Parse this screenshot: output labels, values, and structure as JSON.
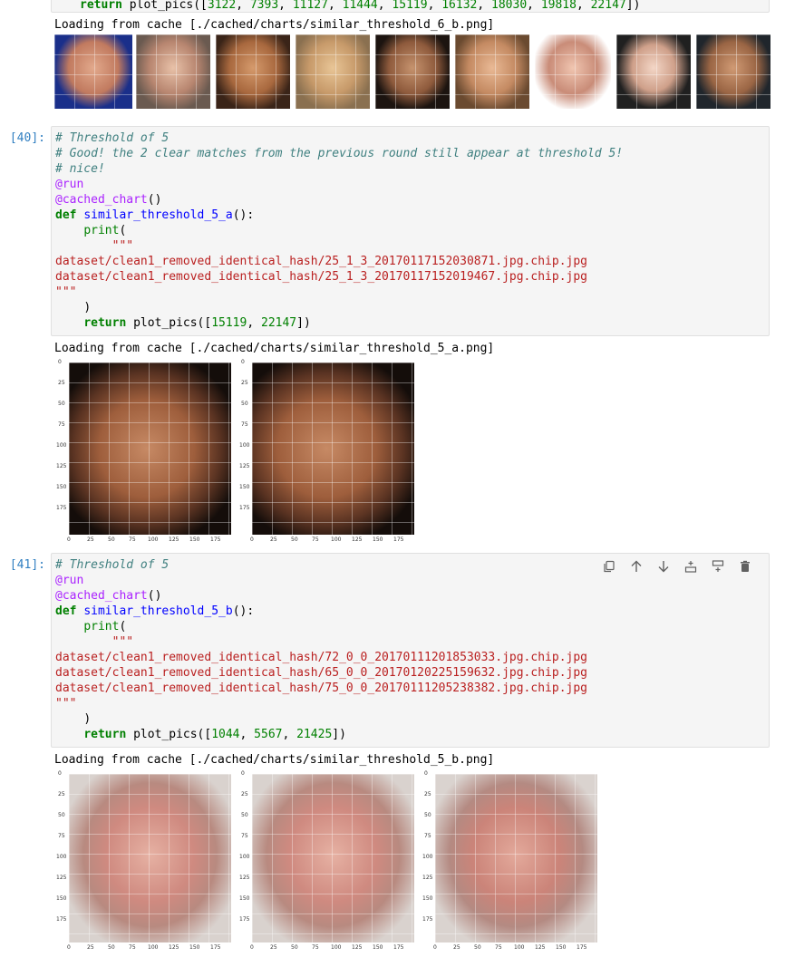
{
  "cell39": {
    "prev_code_fragment_parts": [
      "return",
      " plot_pics([",
      "3122",
      ", ",
      "7393",
      ", ",
      "11127",
      ", ",
      "11444",
      ", ",
      "15119",
      ", ",
      "16132",
      ", ",
      "18030",
      ", ",
      "19818",
      ", ",
      "22147",
      "])"
    ],
    "output_text": "Loading from cache [./cached/charts/similar_threshold_6_b.png]",
    "thumbnail_count": 9
  },
  "cell40": {
    "prompt": "[40]:",
    "lines": {
      "c1": "# Threshold of 5",
      "c2": "# Good! the 2 clear matches from the previous round still appear at threshold 5!",
      "c3": "# nice!",
      "d1": "@run",
      "d2": "@cached_chart",
      "d2_tail": "()",
      "def_kw": "def",
      "fn_name": "similar_threshold_5_a",
      "def_tail": "():",
      "print_kw": "print",
      "print_tail": "(",
      "triple": "\"\"\"",
      "path1": "dataset/clean1_removed_identical_hash/25_1_3_20170117152030871.jpg.chip.jpg",
      "path2": "dataset/clean1_removed_identical_hash/25_1_3_20170117152019467.jpg.chip.jpg",
      "close_paren": ")",
      "return_kw": "return",
      "return_call": " plot_pics([",
      "n1": "15119",
      "sep": ", ",
      "n2": "22147",
      "end": "])"
    },
    "output_text": "Loading from cache [./cached/charts/similar_threshold_5_a.png]",
    "y_ticks": [
      "0",
      "25",
      "50",
      "75",
      "100",
      "125",
      "150",
      "175"
    ],
    "x_ticks": [
      "0",
      "25",
      "50",
      "75",
      "100",
      "125",
      "150",
      "175"
    ]
  },
  "cell41": {
    "prompt": "[41]:",
    "lines": {
      "c1": "# Threshold of 5",
      "d1": "@run",
      "d2": "@cached_chart",
      "d2_tail": "()",
      "def_kw": "def",
      "fn_name": "similar_threshold_5_b",
      "def_tail": "():",
      "print_kw": "print",
      "print_tail": "(",
      "triple": "\"\"\"",
      "path1": "dataset/clean1_removed_identical_hash/72_0_0_20170111201853033.jpg.chip.jpg",
      "path2": "dataset/clean1_removed_identical_hash/65_0_0_20170120225159632.jpg.chip.jpg",
      "path3": "dataset/clean1_removed_identical_hash/75_0_0_20170111205238382.jpg.chip.jpg",
      "close_paren": ")",
      "return_kw": "return",
      "return_call": " plot_pics([",
      "n1": "1044",
      "sep": ", ",
      "n2": "5567",
      "n3": "21425",
      "end": "])"
    },
    "output_text": "Loading from cache [./cached/charts/similar_threshold_5_b.png]",
    "y_ticks": [
      "0",
      "25",
      "50",
      "75",
      "100",
      "125",
      "150",
      "175"
    ],
    "x_ticks": [
      "0",
      "25",
      "50",
      "75",
      "100",
      "125",
      "150",
      "175"
    ],
    "toolbar": [
      "duplicate-icon",
      "move-up-icon",
      "move-down-icon",
      "insert-above-icon",
      "insert-below-icon",
      "delete-icon"
    ]
  }
}
